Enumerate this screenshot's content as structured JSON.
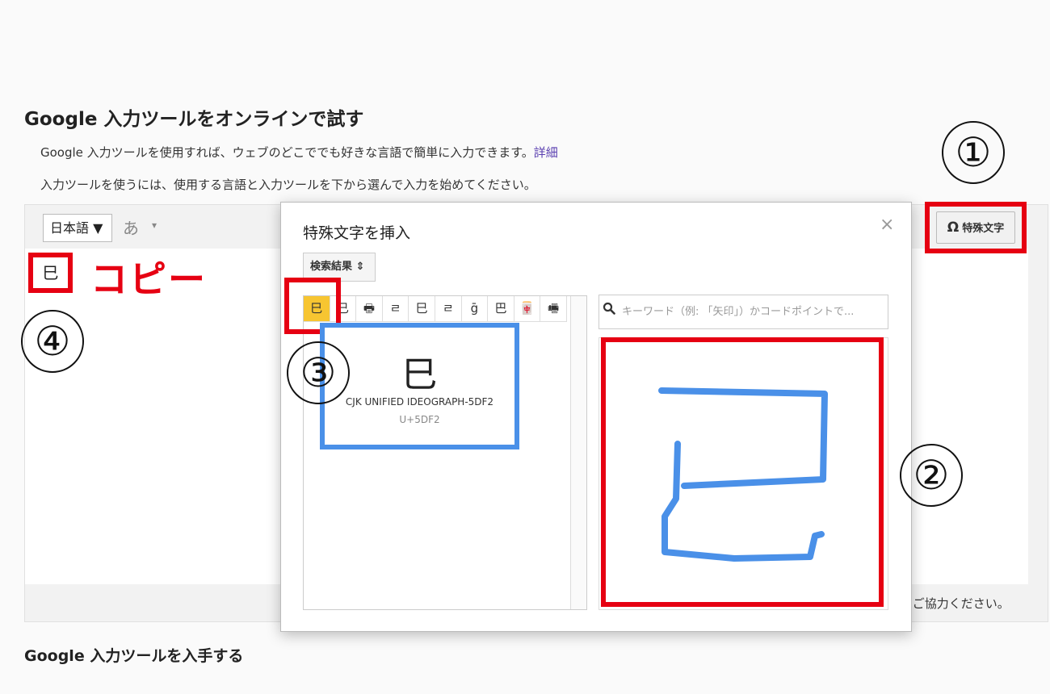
{
  "page": {
    "title": "Google 入力ツールをオンラインで試す",
    "description1": "Google 入力ツールを使用すれば、ウェブのどこででも好きな言語で簡単に入力できます。",
    "description1_link": "詳細",
    "description2": "入力ツールを使うには、使用する言語と入力ツールを下から選んで入力を始めてください。",
    "footer_note": "にご協力ください。",
    "bottom_title": "Google 入力ツールを入手する"
  },
  "toolbar": {
    "language": "日本語 ▼",
    "ime_label": "あ",
    "ime_caret": "▾",
    "special_chars_button": "特殊文字",
    "special_chars_icon": "Ω"
  },
  "editor": {
    "typed_text": "巳"
  },
  "annotations": {
    "copy_label": "コピー",
    "step1": "①",
    "step2": "②",
    "step3": "③",
    "step4": "④",
    "annotation_color": "#e60012",
    "highlight_color": "#4a90e8"
  },
  "dialog": {
    "title": "特殊文字を挿入",
    "close_icon": "×",
    "results_select": "検索結果 ⇕",
    "search_placeholder": "キーワード（例: 「矢印」）かコードポイントで...",
    "search_value": "",
    "candidates": [
      "巳",
      "已",
      "🖶",
      "ㄹ",
      "巳",
      "ㄹ",
      "ḡ",
      "巴",
      "🀄",
      "🖷"
    ],
    "selected_index": 0,
    "preview": {
      "char": "巳",
      "name": "CJK UNIFIED IDEOGRAPH-5DF2",
      "code": "U+5DF2"
    }
  }
}
